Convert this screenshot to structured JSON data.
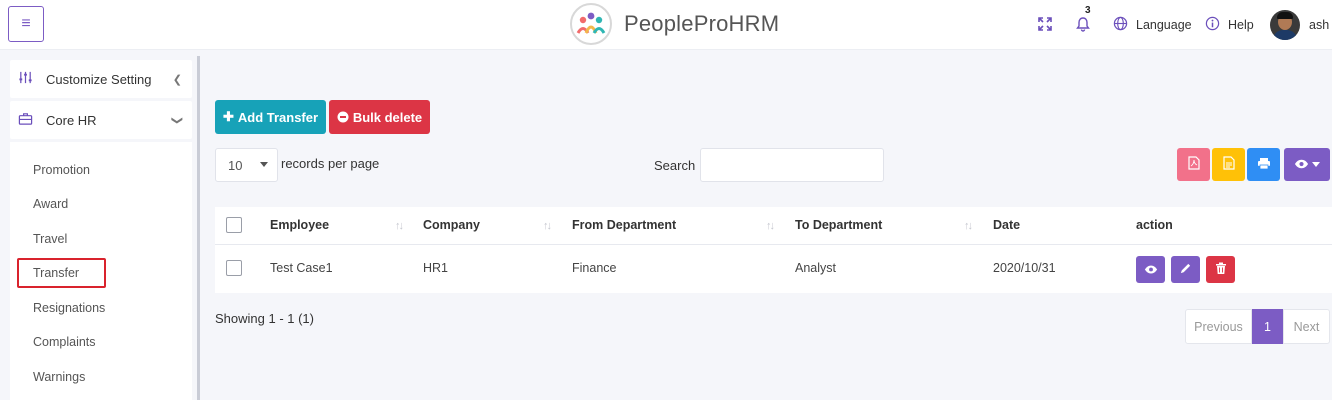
{
  "header": {
    "menu_icon": "hamburger-icon",
    "app_title": "PeopleProHRM",
    "notification_count": "3",
    "language_label": "Language",
    "help_label": "Help",
    "user_name": "ash"
  },
  "sidebar": {
    "customize_setting": "Customize Setting",
    "core_hr": "Core HR",
    "sub_items": [
      "Promotion",
      "Award",
      "Travel",
      "Transfer",
      "Resignations",
      "Complaints",
      "Warnings"
    ],
    "active_item": "Transfer"
  },
  "toolbar": {
    "add_label": "Add Transfer",
    "bulk_delete_label": "Bulk delete",
    "page_size": "10",
    "records_per_page": "records per page",
    "search_label": "Search",
    "search_value": ""
  },
  "table": {
    "columns": [
      "Employee",
      "Company",
      "From Department",
      "To Department",
      "Date",
      "action"
    ],
    "rows": [
      {
        "employee": "Test Case1",
        "company": "HR1",
        "from_department": "Finance",
        "to_department": "Analyst",
        "date": "2020/10/31"
      }
    ]
  },
  "footer": {
    "showing": "Showing 1 - 1 (1)",
    "previous": "Previous",
    "current_page": "1",
    "next": "Next"
  },
  "colors": {
    "primary": "#7c5cc4",
    "info": "#17a2b8",
    "danger": "#dc3545",
    "pdf": "#f2718a",
    "csv": "#ffc107",
    "print": "#2f8ef4"
  }
}
